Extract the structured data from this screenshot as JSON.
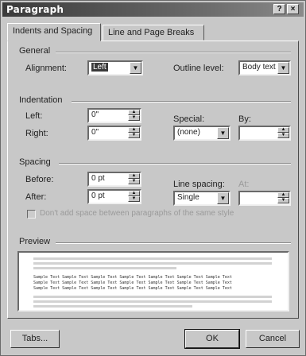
{
  "window": {
    "title": "Paragraph",
    "help_glyph": "?",
    "close_glyph": "×"
  },
  "tabs": [
    {
      "label": "Indents and Spacing",
      "active": true
    },
    {
      "label": "Line and Page Breaks",
      "active": false
    }
  ],
  "general": {
    "heading": "General",
    "alignment_label": "Alignment:",
    "alignment_value": "Left",
    "outline_label": "Outline level:",
    "outline_value": "Body text"
  },
  "indentation": {
    "heading": "Indentation",
    "left_label": "Left:",
    "left_value": "0\"",
    "right_label": "Right:",
    "right_value": "0\"",
    "special_label": "Special:",
    "special_value": "(none)",
    "by_label": "By:",
    "by_value": ""
  },
  "spacing": {
    "heading": "Spacing",
    "before_label": "Before:",
    "before_value": "0 pt",
    "after_label": "After:",
    "after_value": "0 pt",
    "line_spacing_label": "Line spacing:",
    "line_spacing_value": "Single",
    "at_label": "At:",
    "at_value": "",
    "checkbox_label": "Don't add space between paragraphs of the same style"
  },
  "preview": {
    "heading": "Preview",
    "sample_lines": [
      "Sample Text Sample Text Sample Text Sample Text Sample Text Sample Text Sample Text",
      "Sample Text Sample Text Sample Text Sample Text Sample Text Sample Text Sample Text",
      "Sample Text Sample Text Sample Text Sample Text Sample Text Sample Text Sample Text"
    ]
  },
  "buttons": {
    "tabs": "Tabs...",
    "ok": "OK",
    "cancel": "Cancel"
  },
  "colors": {
    "titlebar": "#3a3a3a",
    "face": "#c8c8c8",
    "field": "#ffffff"
  }
}
